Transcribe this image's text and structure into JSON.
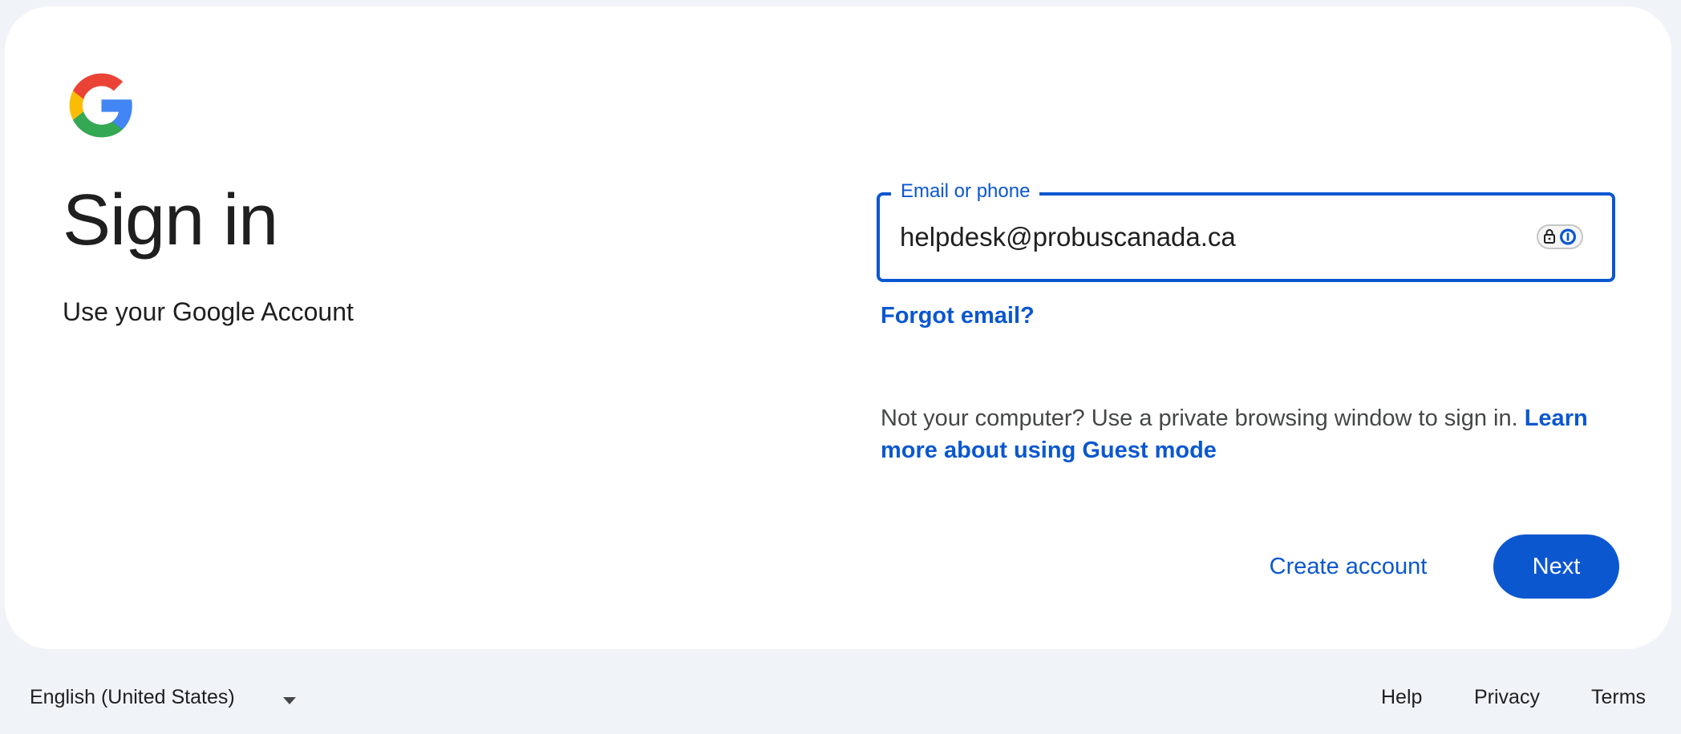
{
  "header": {
    "logo": "google-g-logo",
    "title": "Sign in",
    "subtitle": "Use your Google Account"
  },
  "form": {
    "email_label": "Email or phone",
    "email_value": "helpdesk@probuscanada.ca",
    "password_manager_icon": "1password-lock-icon",
    "forgot_email": "Forgot email?",
    "guest_text": "Not your computer? Use a private browsing window to sign in.",
    "guest_link": "Learn more about using Guest mode",
    "create_account": "Create account",
    "next": "Next"
  },
  "footer": {
    "language": "English (United States)",
    "links": [
      "Help",
      "Privacy",
      "Terms"
    ]
  },
  "colors": {
    "accent": "#0b57d0",
    "background": "#f0f4f9",
    "card": "#ffffff",
    "text": "#1f1f1f",
    "google_blue": "#4285f4",
    "google_red": "#ea4335",
    "google_yellow": "#fbbc05",
    "google_green": "#34a853"
  }
}
